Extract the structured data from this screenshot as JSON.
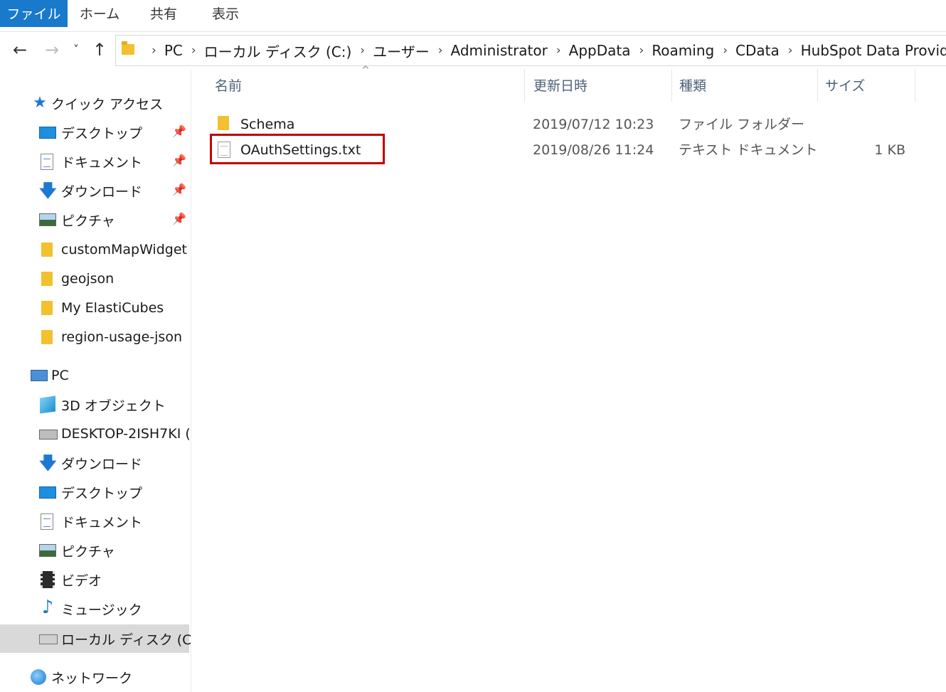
{
  "ribbon": {
    "tabs": [
      "ファイル",
      "ホーム",
      "共有",
      "表示"
    ]
  },
  "nav": {
    "back_icon": "←",
    "forward_icon": "→",
    "recent_icon": "˅",
    "up_icon": "↑",
    "breadcrumbs": [
      "PC",
      "ローカル ディスク (C:)",
      "ユーザー",
      "Administrator",
      "AppData",
      "Roaming",
      "CData",
      "HubSpot Data Provider"
    ],
    "separator": "›"
  },
  "sidebar": {
    "quick_access": "クイック アクセス",
    "pinned": [
      {
        "label": "デスクトップ",
        "icon": "desktop-icon"
      },
      {
        "label": "ドキュメント",
        "icon": "document-icon"
      },
      {
        "label": "ダウンロード",
        "icon": "download-icon"
      },
      {
        "label": "ピクチャ",
        "icon": "picture-icon"
      }
    ],
    "folders": [
      "customMapWidget",
      "geojson",
      "My ElastiCubes",
      "region-usage-json"
    ],
    "pc": "PC",
    "pc_items": [
      {
        "label": "3D オブジェクト",
        "icon": "3d-objects-icon"
      },
      {
        "label": "DESKTOP-2ISH7KI (",
        "icon": "network-drive-icon"
      },
      {
        "label": "ダウンロード",
        "icon": "download-icon"
      },
      {
        "label": "デスクトップ",
        "icon": "desktop-icon"
      },
      {
        "label": "ドキュメント",
        "icon": "document-icon"
      },
      {
        "label": "ピクチャ",
        "icon": "picture-icon"
      },
      {
        "label": "ビデオ",
        "icon": "video-icon"
      },
      {
        "label": "ミュージック",
        "icon": "music-icon"
      },
      {
        "label": "ローカル ディスク (C:)",
        "icon": "local-disk-icon",
        "selected": true
      }
    ],
    "network": "ネットワーク"
  },
  "columns": {
    "name": "名前",
    "date": "更新日時",
    "type": "種類",
    "size": "サイズ"
  },
  "files": [
    {
      "name": "Schema",
      "date": "2019/07/12 10:23",
      "type": "ファイル フォルダー",
      "size": "",
      "icon": "folder-icon"
    },
    {
      "name": "OAuthSettings.txt",
      "date": "2019/08/26 11:24",
      "type": "テキスト ドキュメント",
      "size": "1 KB",
      "icon": "text-file-icon",
      "highlighted": true
    }
  ],
  "colors": {
    "accent": "#1979ca",
    "highlight": "#c00000",
    "folder": "#f3c02e"
  }
}
